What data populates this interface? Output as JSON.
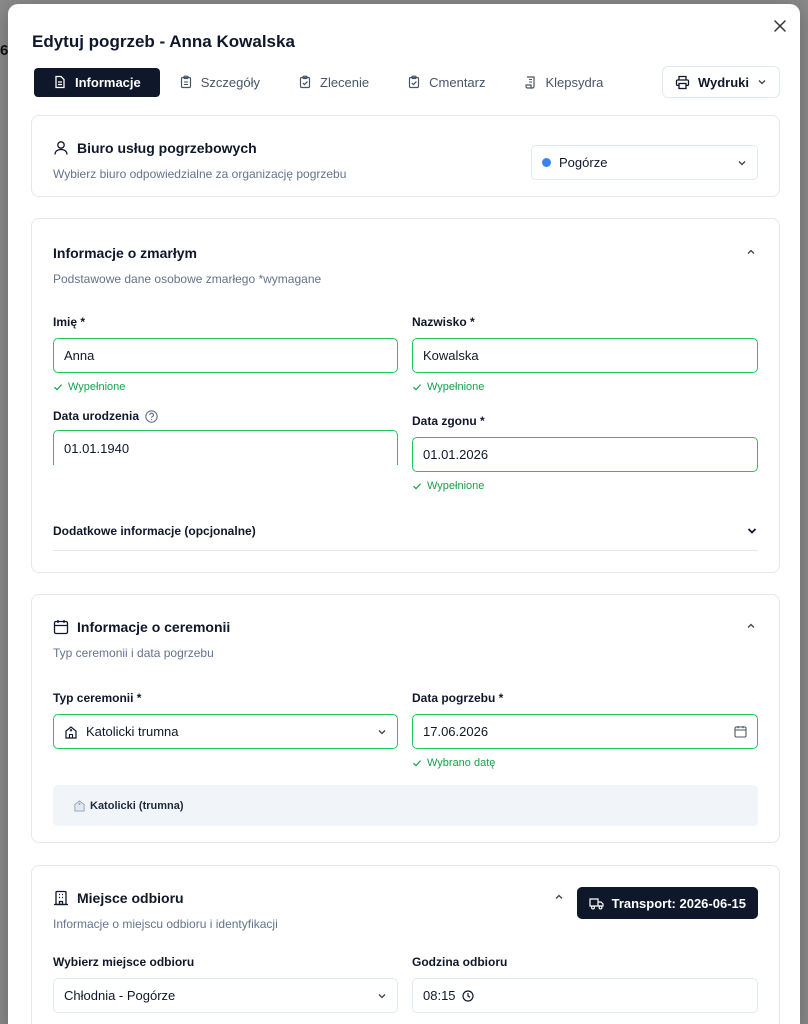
{
  "backdrop_text": "6",
  "dialog": {
    "title": "Edytuj pogrzeb - Anna Kowalska",
    "close_icon": "close-icon"
  },
  "tabs": [
    {
      "label": "Informacje",
      "icon": "document-icon",
      "active": true
    },
    {
      "label": "Szczegóły",
      "icon": "clipboard-list-icon",
      "active": false
    },
    {
      "label": "Zlecenie",
      "icon": "clipboard-check-icon",
      "active": false
    },
    {
      "label": "Cmentarz",
      "icon": "clipboard-check-icon",
      "active": false
    },
    {
      "label": "Klepsydra",
      "icon": "scroll-icon",
      "active": false
    }
  ],
  "wydruki": {
    "label": "Wydruki",
    "icon": "printer-icon"
  },
  "funeral_home": {
    "title": "Biuro usług pogrzebowych",
    "subtitle": "Wybierz biuro odpowiedzialne za organizację pogrzebu",
    "selected": "Pogórze",
    "dot_color": "#3b82f6"
  },
  "deceased": {
    "title": "Informacje o zmarłym",
    "subtitle": "Podstawowe dane osobowe zmarłego *wymagane",
    "first_name_label": "Imię *",
    "first_name_value": "Anna",
    "first_name_status": "Wypełnione",
    "last_name_label": "Nazwisko *",
    "last_name_value": "Kowalska",
    "last_name_status": "Wypełnione",
    "birth_label": "Data urodzenia",
    "birth_value": "01.01.1940",
    "death_label": "Data zgonu *",
    "death_value": "01.01.2026",
    "death_status": "Wypełnione",
    "extra_label": "Dodatkowe informacje (opcjonalne)"
  },
  "ceremony": {
    "title": "Informacje o ceremonii",
    "subtitle": "Typ ceremonii i data pogrzebu",
    "type_label": "Typ ceremonii *",
    "type_value": "Katolicki trumna",
    "date_label": "Data pogrzebu *",
    "date_value": "17.06.2026",
    "date_status": "Wybrano datę",
    "info_text": "Katolicki (trumna)"
  },
  "pickup": {
    "title": "Miejsce odbioru",
    "subtitle": "Informacje o miejscu odbioru i identyfikacji",
    "transport_label": "Transport: 2026-06-15",
    "place_label": "Wybierz miejsce odbioru",
    "place_value": "Chłodnia - Pogórze",
    "time_label": "Godzina odbioru",
    "time_value": "08:15"
  },
  "colors": {
    "accent": "#0f172a",
    "success": "#16a34a",
    "success_border": "#22c55e"
  }
}
